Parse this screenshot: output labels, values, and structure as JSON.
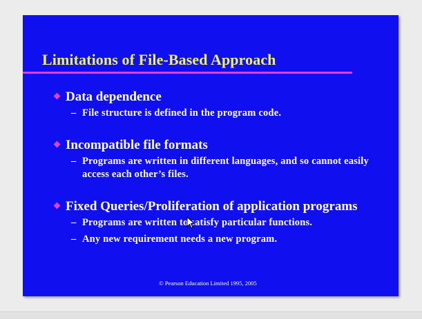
{
  "slide": {
    "title": "Limitations of File-Based Approach",
    "bullets": [
      {
        "heading": "Data dependence",
        "subs": [
          "File structure is defined in the program code."
        ]
      },
      {
        "heading": "Incompatible file formats",
        "subs": [
          "Programs are written in different languages, and so cannot easily access each other’s files."
        ]
      },
      {
        "heading": "Fixed Queries/Proliferation of application programs",
        "subs": [
          "Programs are written to satisfy particular functions.",
          "Any new requirement needs a new program."
        ]
      }
    ],
    "dash": "–",
    "footer": "© Pearson Education Limited 1995, 2005"
  },
  "colors": {
    "slide_background": "#0f0ff0",
    "title_text": "#f0f060",
    "underline": "#e63cd2",
    "bullet_marker": "#e040d0",
    "body_text": "#ffffff"
  },
  "icons": {
    "bullet": "diamond-bullet-icon",
    "pointer": "mouse-cursor-icon"
  }
}
